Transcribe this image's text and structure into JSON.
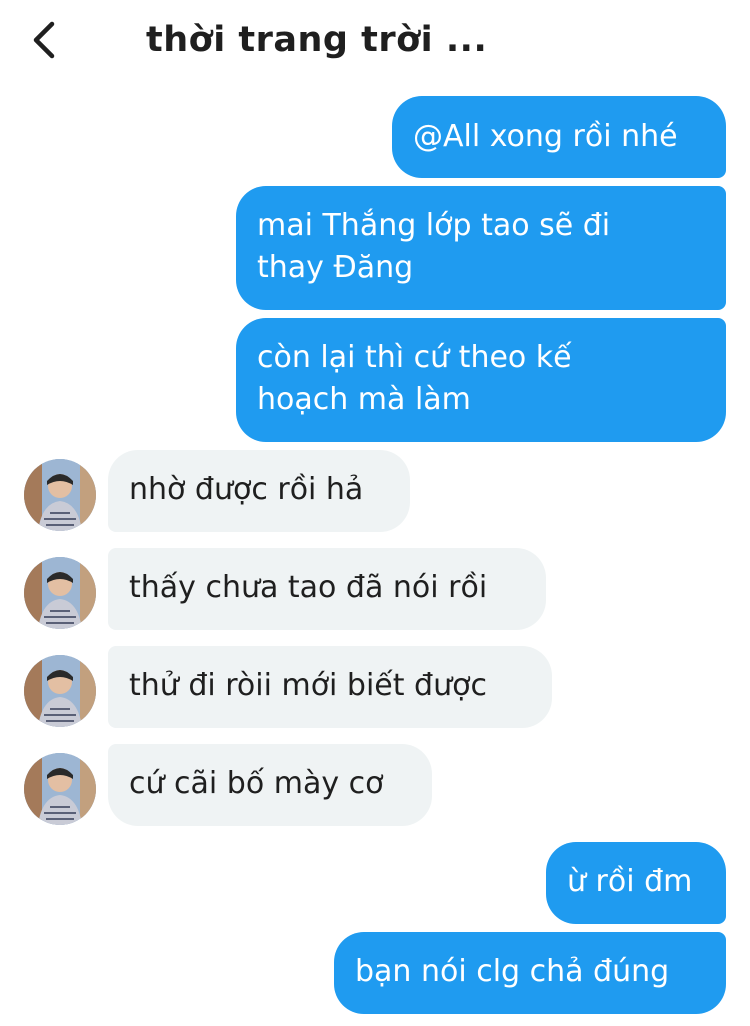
{
  "header": {
    "back_icon": "chevron-left-icon",
    "title": "thời trang trời ..."
  },
  "messages": [
    {
      "direction": "outgoing",
      "text": "@All xong rồi nhé"
    },
    {
      "direction": "outgoing",
      "text_lines": [
        "mai Thắng lớp tao sẽ đi",
        "thay Đăng"
      ]
    },
    {
      "direction": "outgoing",
      "text_lines": [
        "còn lại thì cứ theo kế",
        "hoạch mà làm"
      ]
    },
    {
      "direction": "incoming",
      "text": "nhờ được rồi hả"
    },
    {
      "direction": "incoming",
      "text": "thấy chưa tao đã nói rồi"
    },
    {
      "direction": "incoming",
      "text": "thử đi ròii mới biết được"
    },
    {
      "direction": "incoming",
      "text": "cứ cãi bố mày cơ"
    },
    {
      "direction": "outgoing",
      "text": "ừ rồi đm"
    },
    {
      "direction": "outgoing",
      "text": "bạn nói clg chả đúng"
    }
  ],
  "colors": {
    "outgoing_bubble": "#1f9bf0",
    "incoming_bubble": "#eff3f4",
    "outgoing_text": "#ffffff",
    "incoming_text": "#1f1f1f"
  }
}
